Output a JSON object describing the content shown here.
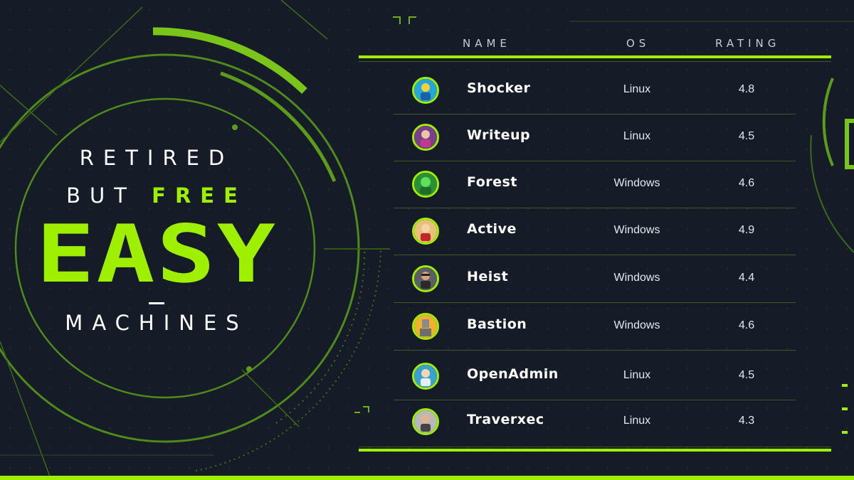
{
  "hero": {
    "line1": "RETIRED",
    "line2_prefix": "BUT",
    "line2_accent": "FREE",
    "big_word": "EASY",
    "line4": "MACHINES"
  },
  "table": {
    "headers": {
      "name": "NAME",
      "os": "OS",
      "rating": "RATING"
    },
    "rows": [
      {
        "name": "Shocker",
        "os": "Linux",
        "rating": "4.8",
        "avatar_color": "#27a7d8"
      },
      {
        "name": "Writeup",
        "os": "Linux",
        "rating": "4.5",
        "avatar_color": "#7a3f8a"
      },
      {
        "name": "Forest",
        "os": "Windows",
        "rating": "4.6",
        "avatar_color": "#2b8f3a"
      },
      {
        "name": "Active",
        "os": "Windows",
        "rating": "4.9",
        "avatar_color": "#e8c07a"
      },
      {
        "name": "Heist",
        "os": "Windows",
        "rating": "4.4",
        "avatar_color": "#5a5f66"
      },
      {
        "name": "Bastion",
        "os": "Windows",
        "rating": "4.6",
        "avatar_color": "#f0b030"
      },
      {
        "name": "OpenAdmin",
        "os": "Linux",
        "rating": "4.5",
        "avatar_color": "#3aa0d0"
      },
      {
        "name": "Traverxec",
        "os": "Linux",
        "rating": "4.3",
        "avatar_color": "#b8b8b8"
      }
    ]
  },
  "colors": {
    "accent": "#9fef00",
    "background": "#151c27",
    "divider": "#40582a"
  }
}
